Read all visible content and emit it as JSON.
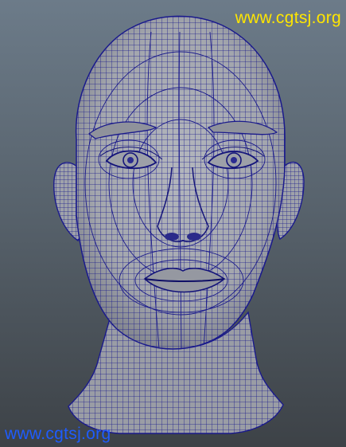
{
  "viewport": {
    "background_top": "#6c7b89",
    "background_bottom": "#3d4247"
  },
  "model": {
    "subject": "head-mesh-icon",
    "surface_color": "#a3a6ad",
    "wire_color": "#1a1a8c",
    "shadow_color": "#7d8089"
  },
  "watermark": {
    "top_text": "www.cgtsj.org",
    "top_color": "#ffe600",
    "bottom_text": "www.cgtsj.org",
    "bottom_color": "#1e5cff"
  }
}
